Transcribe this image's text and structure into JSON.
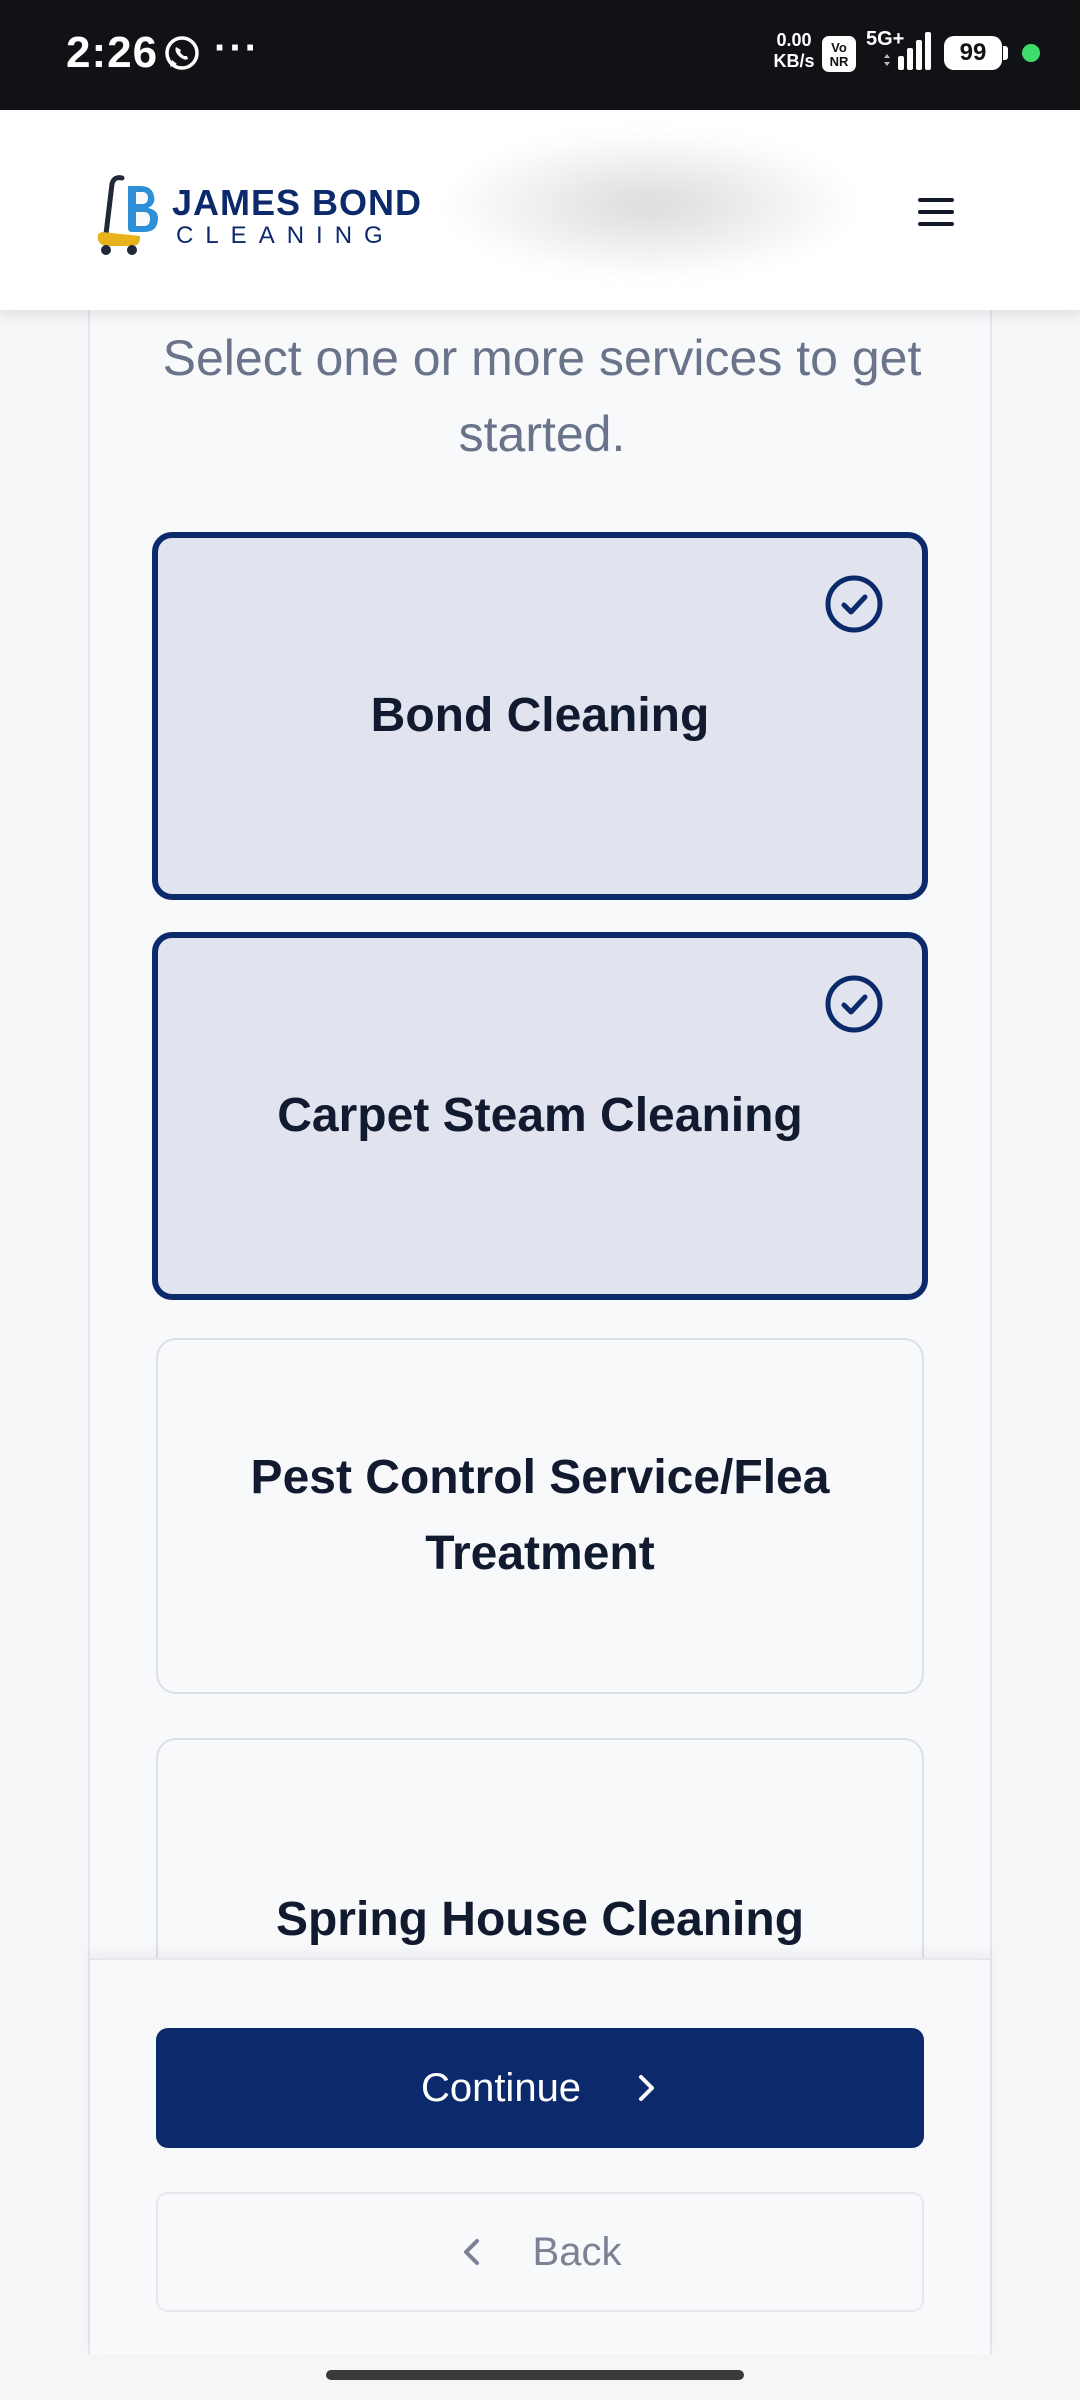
{
  "status_bar": {
    "time": "2:26",
    "more": "···",
    "net_speed_value": "0.00",
    "net_speed_unit": "KB/s",
    "volte_line1": "Vo",
    "volte_line2": "NR",
    "network": "5G+",
    "battery": "99",
    "icons": [
      "whatsapp-icon",
      "signal-icon",
      "battery-icon"
    ]
  },
  "header": {
    "brand_top": "JAMES BOND",
    "brand_bottom": "CLEANING",
    "menu_icon": "hamburger-menu-icon"
  },
  "main": {
    "subtitle": "Select one or more services to get started.",
    "services": [
      {
        "label": "Bond Cleaning",
        "selected": true
      },
      {
        "label": "Carpet Steam Cleaning",
        "selected": true
      },
      {
        "label": "Pest Control Service/Flea Treatment",
        "selected": false
      },
      {
        "label": "Spring House Cleaning",
        "selected": false
      }
    ]
  },
  "footer": {
    "continue_label": "Continue",
    "back_label": "Back"
  },
  "colors": {
    "brand_navy": "#0c2a6b",
    "selected_card_bg": "#e1e3ef",
    "status_bar_bg": "#111215",
    "subtitle_text": "#69748a"
  }
}
